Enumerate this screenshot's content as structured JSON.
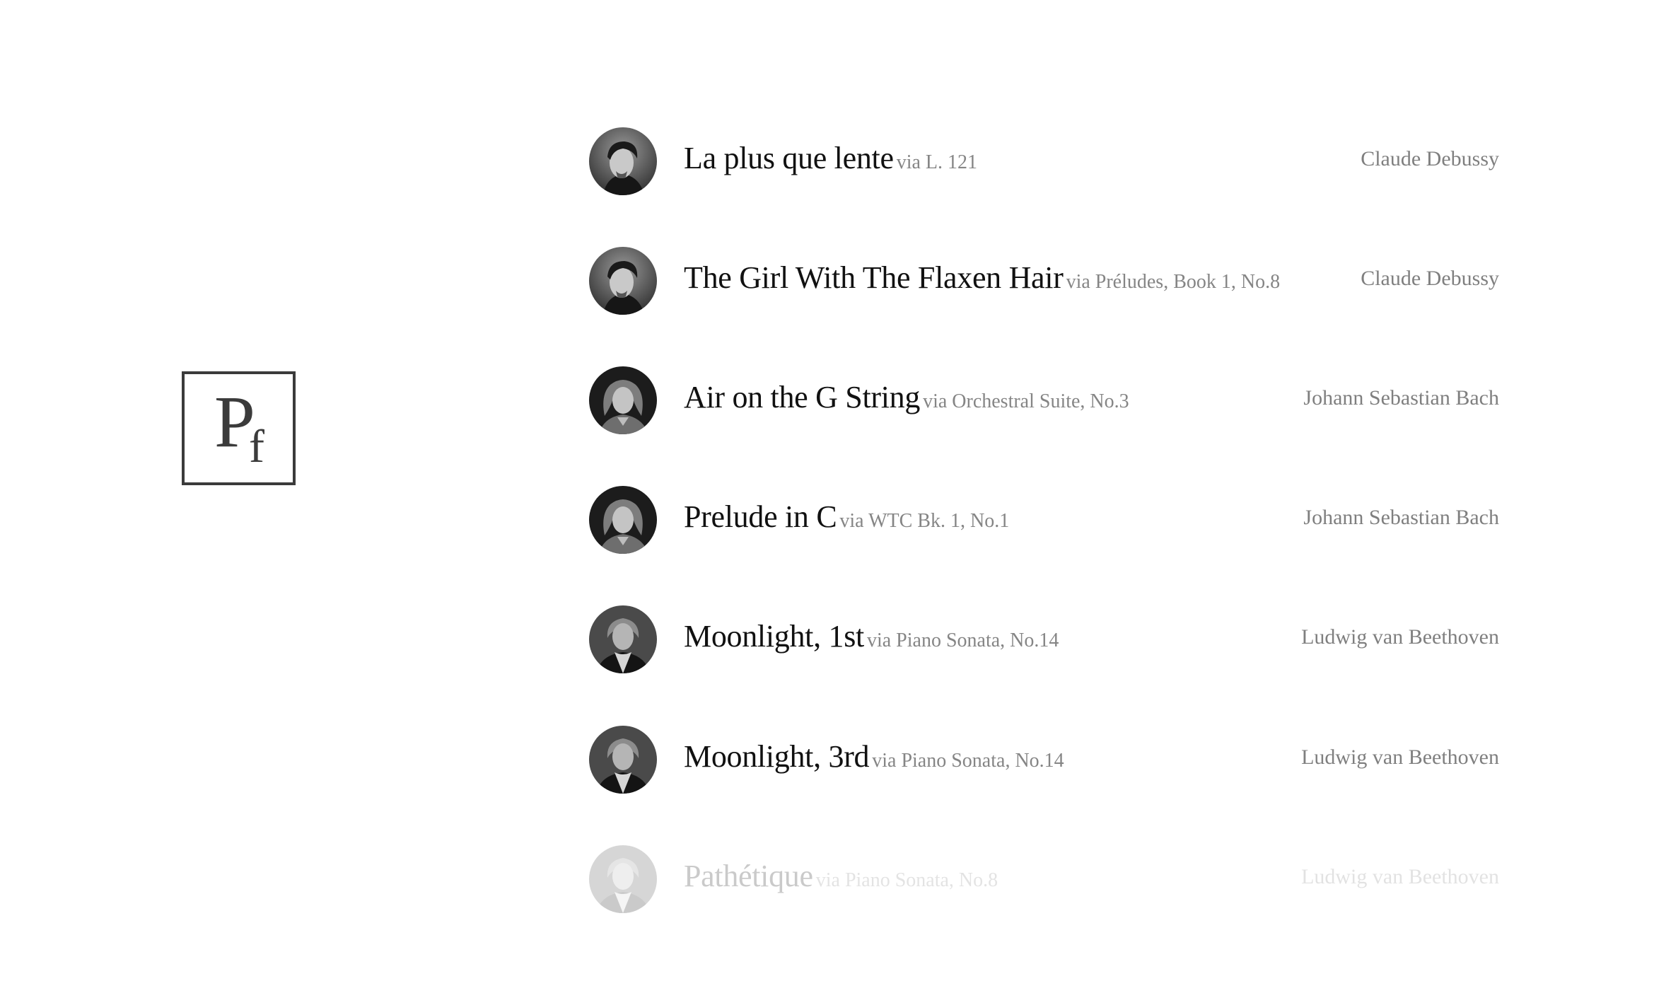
{
  "logo": {
    "letter_main": "P",
    "letter_sub": "f"
  },
  "tracks": [
    {
      "title": "La plus que lente",
      "via": "via L. 121",
      "composer": "Claude Debussy",
      "portrait": "debussy-portrait"
    },
    {
      "title": "The Girl With The Flaxen Hair",
      "via": "via Préludes, Book 1, No.8",
      "composer": "Claude Debussy",
      "portrait": "debussy-portrait"
    },
    {
      "title": "Air on the G String",
      "via": "via Orchestral Suite, No.3",
      "composer": "Johann Sebastian Bach",
      "portrait": "bach-portrait"
    },
    {
      "title": "Prelude in C",
      "via": "via WTC Bk. 1, No.1",
      "composer": "Johann Sebastian Bach",
      "portrait": "bach-portrait"
    },
    {
      "title": "Moonlight, 1st",
      "via": "via Piano Sonata, No.14",
      "composer": "Ludwig van Beethoven",
      "portrait": "beethoven-portrait"
    },
    {
      "title": "Moonlight, 3rd",
      "via": "via Piano Sonata, No.14",
      "composer": "Ludwig van Beethoven",
      "portrait": "beethoven-portrait"
    },
    {
      "title": "Pathétique",
      "via": "via Piano Sonata, No.8",
      "composer": "Ludwig van Beethoven",
      "portrait": "beethoven-portrait"
    }
  ]
}
